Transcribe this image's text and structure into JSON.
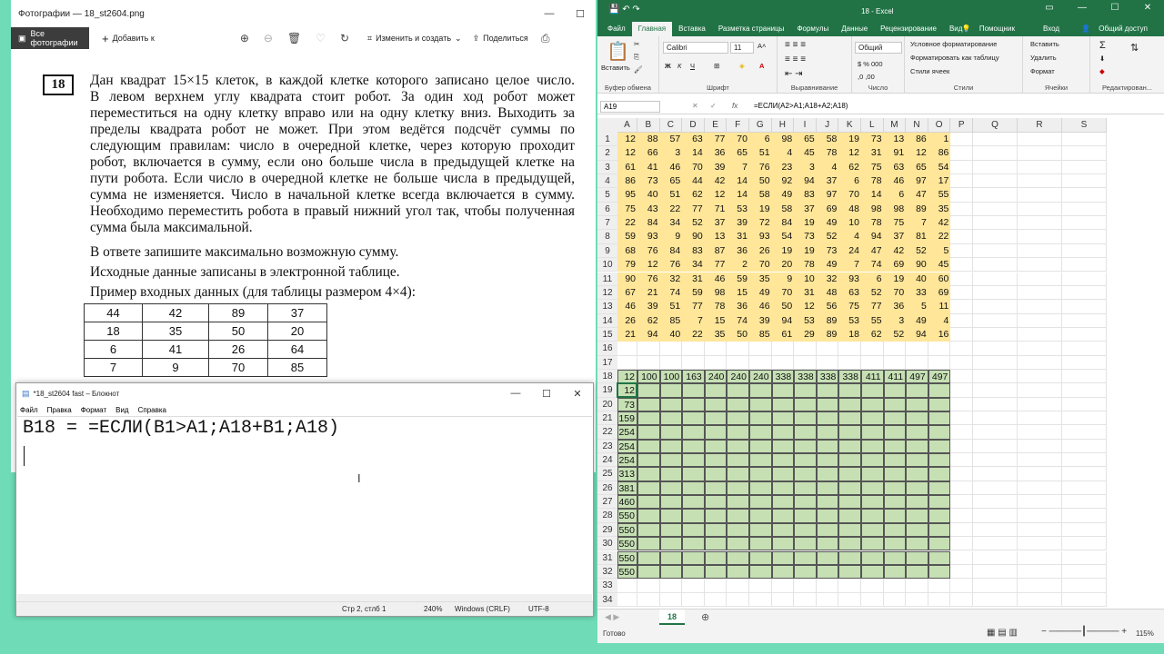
{
  "photos": {
    "title": "Фотографии — 18_st2604.png",
    "all_photos": "Все фотографии",
    "add_to": "Добавить к",
    "edit_create": "Изменить и создать",
    "share": "Поделиться",
    "task_number": "18",
    "paragraph_lines": [
      "Дан квадрат 15×15 клеток, в каждой клетке которого записано целое число.",
      "В левом верхнем углу квадрата стоит робот. За один ход робот может",
      "переместиться на одну клетку вправо или на одну клетку вниз. Выходить за",
      "пределы квадрата робот не может. При этом ведётся подсчёт суммы по",
      "следующим правилам: число в очередной клетке, через которую проходит",
      "робот, включается в сумму, если оно больше числа в предыдущей клетке на",
      "пути робота. Если число в очередной клетке не больше числа в предыдущей,",
      "сумма не изменяется. Число в начальной клетке всегда включается в сумму.",
      "Необходимо переместить робота в правый нижний угол так, чтобы полученная",
      "сумма была максимальной."
    ],
    "answer_line": "В ответе запишите максимально возможную сумму.",
    "source_line": "Исходные данные записаны в электронной таблице.",
    "example_line": "Пример входных данных (для таблицы размером 4×4):",
    "example_table": [
      [
        "44",
        "42",
        "89",
        "37"
      ],
      [
        "18",
        "35",
        "50",
        "20"
      ],
      [
        "6",
        "41",
        "26",
        "64"
      ],
      [
        "7",
        "9",
        "70",
        "85"
      ]
    ]
  },
  "notepad": {
    "title": "*18_st2604 fast – Блокнот",
    "menu": [
      "Файл",
      "Правка",
      "Формат",
      "Вид",
      "Справка"
    ],
    "text": "B18 = =ЕСЛИ(B1>A1;A18+B1;A18)",
    "status_pos": "Стр 2, стлб 1",
    "status_zoom": "240%",
    "status_eol": "Windows (CRLF)",
    "status_enc": "UTF-8"
  },
  "excel": {
    "title": "18 - Excel",
    "tabs": [
      "Файл",
      "Главная",
      "Вставка",
      "Разметка страницы",
      "Формулы",
      "Данные",
      "Рецензирование",
      "Вид"
    ],
    "help": "Помощник",
    "signin": "Вход",
    "share": "Общий доступ",
    "font_name": "Calibri",
    "font_size": "11",
    "number_format": "Общий",
    "paste": "Вставить",
    "group_clipboard": "Буфер обмена",
    "group_font": "Шрифт",
    "group_align": "Выравнивание",
    "group_number": "Число",
    "group_styles": "Стили",
    "group_cells": "Ячейки",
    "group_editing": "Редактирован...",
    "cond_format": "Условное форматирование",
    "format_table": "Форматировать как таблицу",
    "cell_styles": "Стили ячеек",
    "insert": "Вставить",
    "delete": "Удалить",
    "format": "Формат",
    "name_box": "A19",
    "formula": "=ЕСЛИ(A2>A1;A18+A2;A18)",
    "columns": [
      "A",
      "B",
      "C",
      "D",
      "E",
      "F",
      "G",
      "H",
      "I",
      "J",
      "K",
      "L",
      "M",
      "N",
      "O",
      "P",
      "Q",
      "R",
      "S"
    ],
    "data_rows": [
      [
        12,
        88,
        57,
        63,
        77,
        70,
        6,
        98,
        65,
        58,
        19,
        73,
        13,
        86,
        1
      ],
      [
        12,
        66,
        3,
        14,
        36,
        65,
        51,
        4,
        45,
        78,
        12,
        31,
        91,
        12,
        86
      ],
      [
        61,
        41,
        46,
        70,
        39,
        7,
        76,
        23,
        3,
        4,
        62,
        75,
        63,
        65,
        54
      ],
      [
        86,
        73,
        65,
        44,
        42,
        14,
        50,
        92,
        94,
        37,
        6,
        78,
        46,
        97,
        17
      ],
      [
        95,
        40,
        51,
        62,
        12,
        14,
        58,
        49,
        83,
        97,
        70,
        14,
        6,
        47,
        55
      ],
      [
        75,
        43,
        22,
        77,
        71,
        53,
        19,
        58,
        37,
        69,
        48,
        98,
        98,
        89,
        35
      ],
      [
        22,
        84,
        34,
        52,
        37,
        39,
        72,
        84,
        19,
        49,
        10,
        78,
        75,
        7,
        42
      ],
      [
        59,
        93,
        9,
        90,
        13,
        31,
        93,
        54,
        73,
        52,
        4,
        94,
        37,
        81,
        22
      ],
      [
        68,
        76,
        84,
        83,
        87,
        36,
        26,
        19,
        19,
        73,
        24,
        47,
        42,
        52,
        5
      ],
      [
        79,
        12,
        76,
        34,
        77,
        2,
        70,
        20,
        78,
        49,
        7,
        74,
        69,
        90,
        45
      ],
      [
        90,
        76,
        32,
        31,
        46,
        59,
        35,
        9,
        10,
        32,
        93,
        6,
        19,
        40,
        60
      ],
      [
        67,
        21,
        74,
        59,
        98,
        15,
        49,
        70,
        31,
        48,
        63,
        52,
        70,
        33,
        69
      ],
      [
        46,
        39,
        51,
        77,
        78,
        36,
        46,
        50,
        12,
        56,
        75,
        77,
        36,
        5,
        11
      ],
      [
        26,
        62,
        85,
        7,
        15,
        74,
        39,
        94,
        53,
        89,
        53,
        55,
        3,
        49,
        4
      ],
      [
        21,
        94,
        40,
        22,
        35,
        50,
        85,
        61,
        29,
        89,
        18,
        62,
        52,
        94,
        16
      ]
    ],
    "row18": [
      12,
      100,
      100,
      163,
      240,
      240,
      240,
      338,
      338,
      338,
      338,
      411,
      411,
      497,
      497
    ],
    "colA_19_32": [
      12,
      73,
      159,
      254,
      254,
      254,
      313,
      381,
      460,
      550,
      550,
      550,
      550,
      550
    ],
    "sheet_name": "18",
    "status_ready": "Готово",
    "zoom": "115%"
  },
  "colors": {
    "yellow": "#ffe699",
    "green": "#c6e0b4",
    "excel_green": "#217346"
  }
}
